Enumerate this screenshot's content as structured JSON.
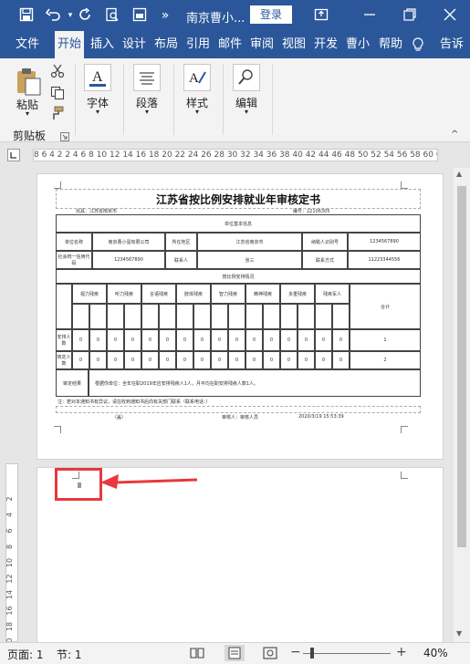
{
  "titlebar": {
    "doc_title": "南京曹小...",
    "login": "登录",
    "more": "»"
  },
  "tabs": [
    {
      "label": "文件"
    },
    {
      "label": "开始"
    },
    {
      "label": "插入"
    },
    {
      "label": "设计"
    },
    {
      "label": "布局"
    },
    {
      "label": "引用"
    },
    {
      "label": "邮件"
    },
    {
      "label": "审阅"
    },
    {
      "label": "视图"
    },
    {
      "label": "开发"
    },
    {
      "label": "曹小"
    },
    {
      "label": "帮助"
    },
    {
      "label": "告诉"
    }
  ],
  "ribbon": {
    "paste": "粘贴",
    "font": "字体",
    "paragraph": "段落",
    "styles": "样式",
    "editing": "编辑",
    "clipboard": "剪贴板"
  },
  "ruler": {
    "numbers": "8  6  4  2     2   4   6   8  10 12 14 16 18 20 22 24 26 28 30 32 34 36 38 40 42 44 46 48 50 52 54 56 58 60    64 66 68 70",
    "vnumbers": [
      "2",
      "4",
      "6",
      "8",
      "10",
      "12",
      "14",
      "16",
      "18",
      "20"
    ]
  },
  "document": {
    "title": "江苏省按比例安排就业年审核定书",
    "issuer": "出具：江苏省南京市",
    "serial": "编号：22106305",
    "unit_info": "单位基本信息",
    "unit_name_label": "单位名称",
    "unit_name": "南京曹小蛋有限公司",
    "region_label": "所在地区",
    "region": "江苏省南京市",
    "taxpayer_label": "纳税人识别号",
    "taxpayer": "1234567890",
    "credit_label": "社会统一信用代码",
    "credit": "1234567890",
    "contact_label": "联系人",
    "contact": "张三",
    "phone_label": "联系方式",
    "phone": "11223344556",
    "disabled_info": "按比例安排情况",
    "categories": [
      "视力残疾",
      "听力残疾",
      "言语残疾",
      "肢体残疾",
      "智力残疾",
      "精神残疾",
      "多重残疾",
      "残疾军人"
    ],
    "total_label": "合计",
    "row1_label": "安排人数",
    "row2_label": "核定人数",
    "total1": "1",
    "total2": "2",
    "audit_label": "审定结果",
    "audit_text": "根据你单位：全年在职2019年应安排残疾人1人，月平均在职安排残疾人数1人。",
    "note": "注：若对本通知书有异议，请在收到通知书后向有关部门联系（联系电话：）",
    "footer_left": "（盖）",
    "footer_mid": "审核人：审核人员",
    "footer_right": "2020/3/19 15:53:39"
  },
  "status": {
    "page": "页面: 1",
    "section": "节: 1",
    "zoom": "40%",
    "minus": "−",
    "plus": "+"
  },
  "colors": {
    "brand": "#2b579a",
    "arrow": "#e8383d"
  }
}
